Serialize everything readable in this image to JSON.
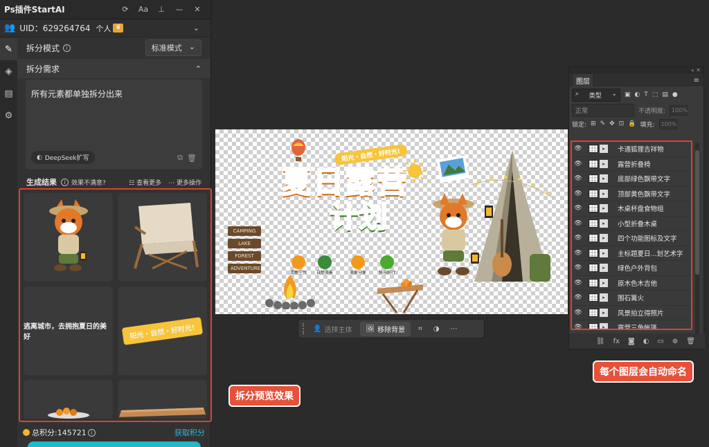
{
  "plugin": {
    "title": "Ps插件StartAI",
    "titlebar_icons": [
      "refresh-icon",
      "font-size-icon",
      "pin-icon",
      "minimize-icon",
      "close-icon"
    ],
    "font_btn": "Aa",
    "uid": "UID：629264764",
    "account_type": "个人",
    "split_mode_label": "拆分模式",
    "split_mode_value": "标准模式",
    "need_label": "拆分需求",
    "need_text": "所有元素都单独拆分出来",
    "deepseek_label": "DeepSeek扩写",
    "result_label": "生成结果",
    "not_satisfied": "效果不满意?",
    "see_more": "查看更多",
    "more_ops": "更多操作",
    "tile_texts": [
      "逃离城市，去拥抱夏日的美好",
      "阳光・自然・好时光!"
    ],
    "points": "总积分:145721",
    "get_points": "获取积分"
  },
  "canvas": {
    "banner": "阳光・自然・好时光!",
    "title_line1": "夏日露营",
    "title_line2": "计划",
    "signs": [
      "CAMPING",
      "LAKE",
      "FOREST",
      "ADVENTURE"
    ],
    "features": [
      "清新空气",
      "自然美景",
      "美食分享",
      "快乐同行"
    ]
  },
  "context_bar": {
    "select_subject": "选择主体",
    "remove_bg": "移除背景"
  },
  "layers_panel": {
    "tab": "图层",
    "kind": "类型",
    "blend": "正常",
    "opacity_label": "不透明度:",
    "opacity_value": "100%",
    "lock_label": "锁定:",
    "fill_label": "填充:",
    "fill_value": "100%",
    "layers": [
      "卡通狐狸吉祥物",
      "露营折叠椅",
      "底部绿色飘带文字",
      "顶部黄色飘带文字",
      "木桌杯盘食物组",
      "小型折叠木桌",
      "四个功能图标及文字",
      "主标题夏日...划艺术字",
      "绿色户外背包",
      "原木色木吉他",
      "围石篝火",
      "风景拍立得照片",
      "露营三角帐篷"
    ]
  },
  "annotations": {
    "preview": "拆分预览效果",
    "auto_name": "每个图层会自动命名"
  },
  "colors": {
    "accent_red": "#d9442f",
    "link_blue": "#2eb8e0",
    "coin": "#f2b62b"
  }
}
